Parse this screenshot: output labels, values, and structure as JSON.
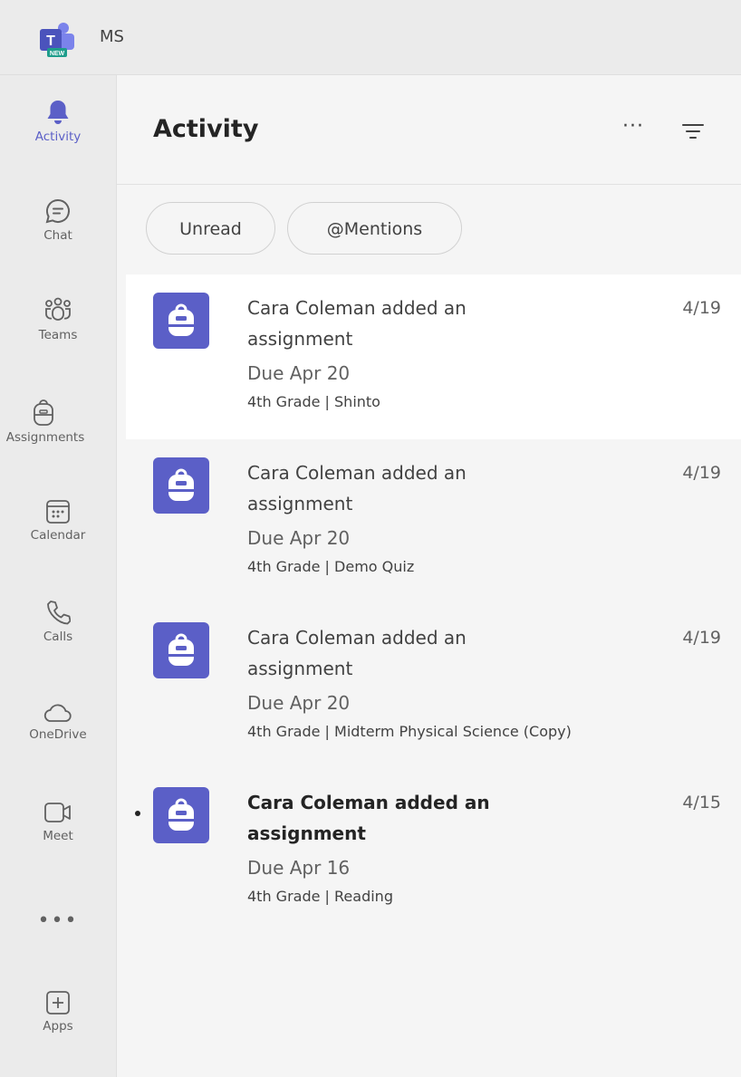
{
  "titlebar": {
    "tenant": "MS",
    "logo_badge": "NEW"
  },
  "rail": {
    "items": [
      {
        "label": "Activity",
        "icon": "bell-icon"
      },
      {
        "label": "Chat",
        "icon": "chat-icon"
      },
      {
        "label": "Teams",
        "icon": "teams-icon"
      },
      {
        "label": "Assignments",
        "icon": "backpack-icon"
      },
      {
        "label": "Calendar",
        "icon": "calendar-icon"
      },
      {
        "label": "Calls",
        "icon": "phone-icon"
      },
      {
        "label": "OneDrive",
        "icon": "cloud-icon"
      },
      {
        "label": "Meet",
        "icon": "video-icon"
      },
      {
        "label": "Apps",
        "icon": "plus-square-icon"
      }
    ],
    "more": "•••"
  },
  "header": {
    "title": "Activity",
    "more": "···"
  },
  "filters": {
    "unread": "Unread",
    "mentions": "@Mentions"
  },
  "feed": [
    {
      "title_line1": "Cara Coleman added an",
      "title_line2": "assignment",
      "date": "4/19",
      "due": "Due Apr 20",
      "sub": "4th Grade | Shinto"
    },
    {
      "title_line1": "Cara Coleman added an",
      "title_line2": "assignment",
      "date": "4/19",
      "due": "Due Apr 20",
      "sub": "4th Grade | Demo Quiz"
    },
    {
      "title_line1": "Cara Coleman added an",
      "title_line2": "assignment",
      "date": "4/19",
      "due": "Due Apr 20",
      "sub": "4th Grade | Midterm Physical Science (Copy)"
    },
    {
      "title_line1": "Cara Coleman added an",
      "title_line2": "assignment",
      "date": "4/15",
      "due": "Due Apr 16",
      "sub": "4th Grade | Reading"
    }
  ],
  "colors": {
    "accent": "#5b5fc7",
    "rail_bg": "#ebebeb",
    "pane_bg": "#f5f5f5"
  }
}
